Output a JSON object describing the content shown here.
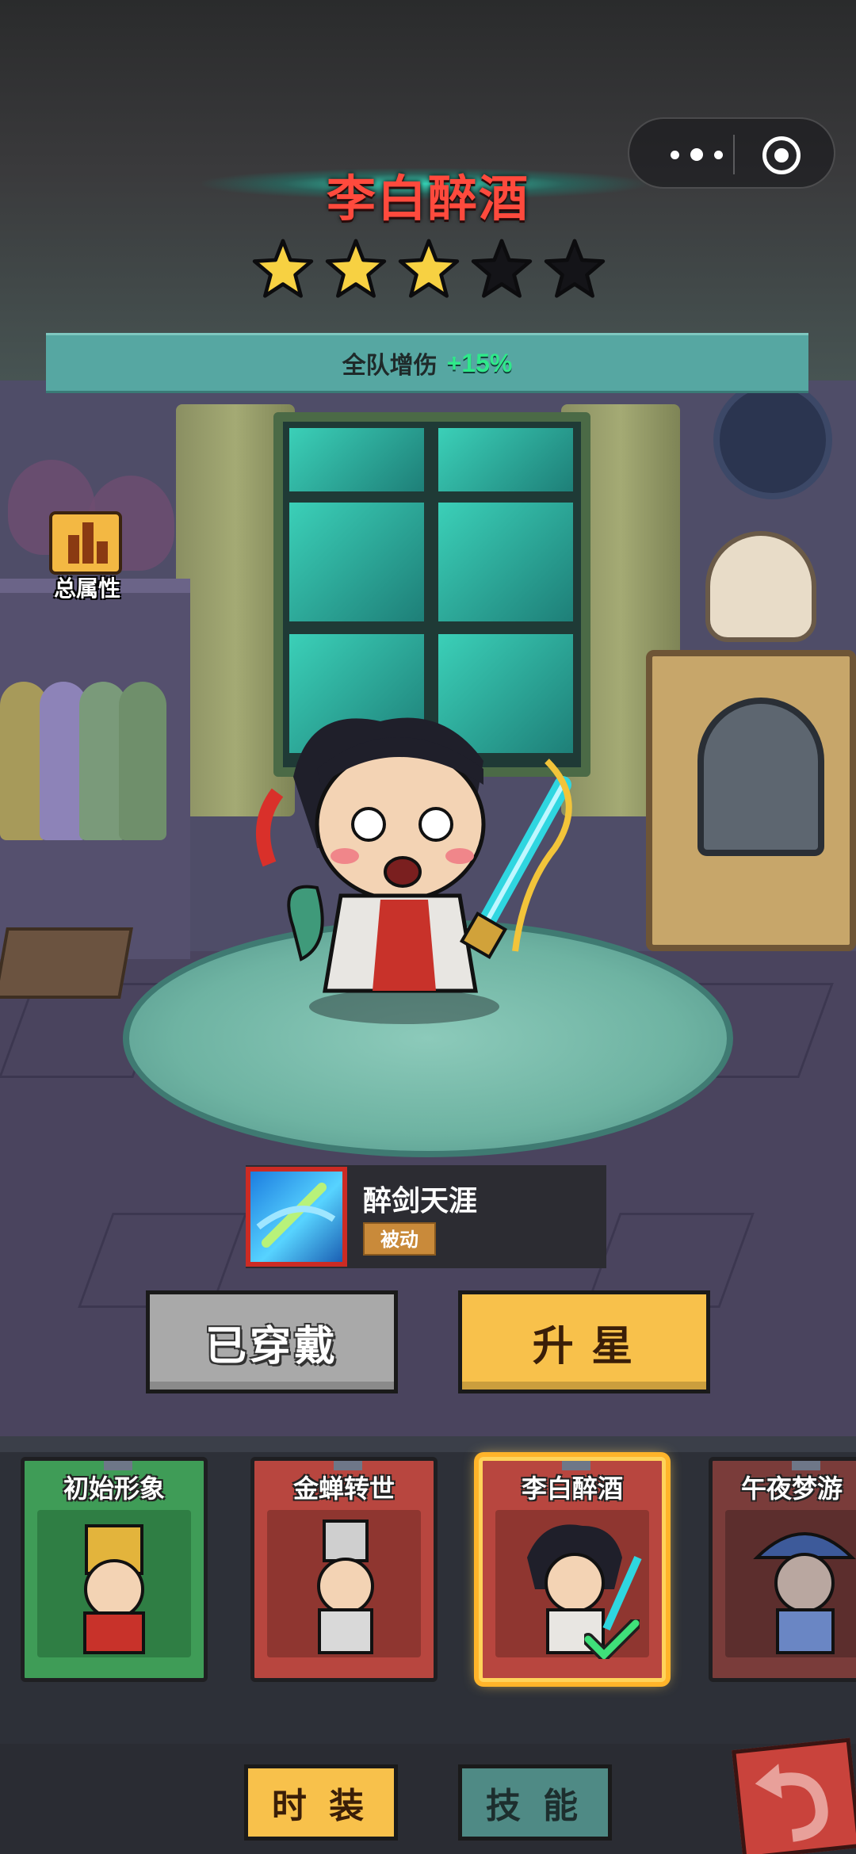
{
  "hero": {
    "name": "李白醉酒",
    "stars_filled": 3,
    "stars_total": 5,
    "buff_label": "全队增伤",
    "buff_value": "+15%"
  },
  "total_attributes_label": "总属性",
  "skill": {
    "name": "醉剑天涯",
    "type": "被动"
  },
  "actions": {
    "equipped_label": "已穿戴",
    "upgrade_star_label": "升 星"
  },
  "skins": [
    {
      "name": "初始形象",
      "selected": false
    },
    {
      "name": "金蝉转世",
      "selected": false
    },
    {
      "name": "李白醉酒",
      "selected": true
    },
    {
      "name": "午夜梦游",
      "selected": false
    }
  ],
  "tabs": {
    "outfit": "时 装",
    "skill": "技 能"
  },
  "colors": {
    "title_red": "#ff4a3d",
    "buff_green": "#2fe98a",
    "star_gold": "#f7d142",
    "button_yellow": "#f8c14b"
  }
}
